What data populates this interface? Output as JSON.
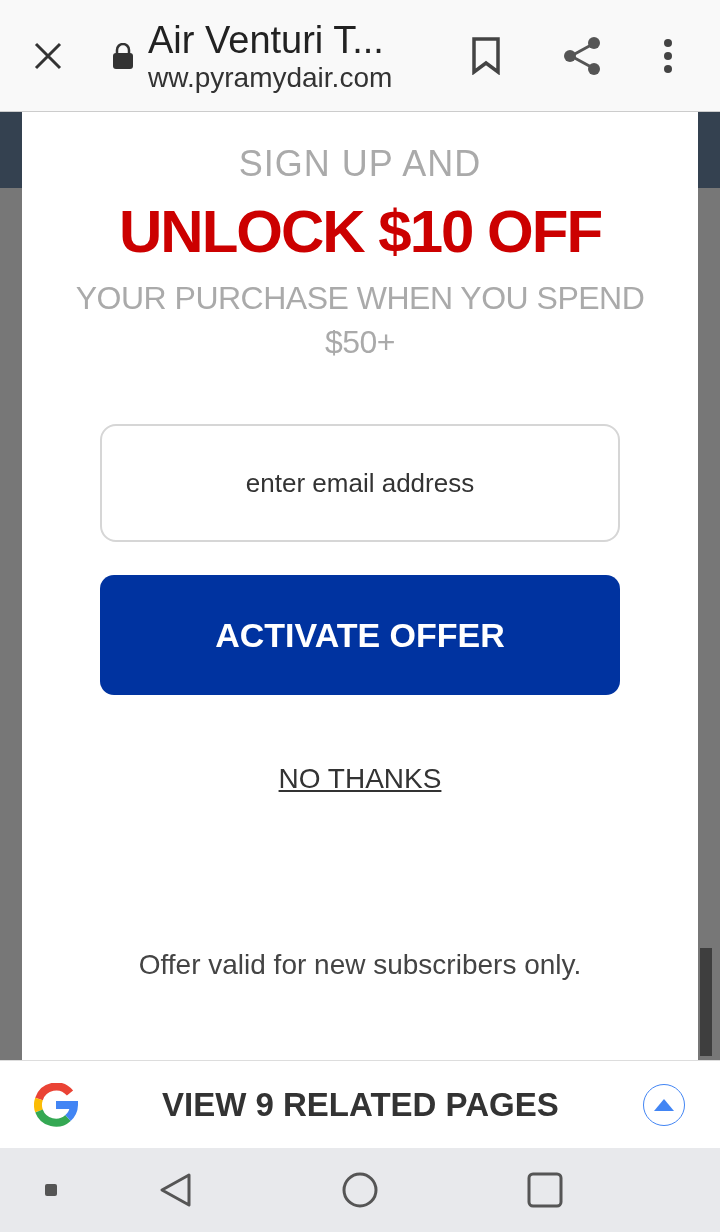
{
  "browser": {
    "title": "Air Venturi T...",
    "url": "ww.pyramydair.com"
  },
  "popup": {
    "kicker": "SIGN UP AND",
    "headline": "UNLOCK $10 OFF",
    "subline": "YOUR PURCHASE WHEN YOU SPEND $50+",
    "email": {
      "placeholder": "enter email address"
    },
    "submit": "ACTIVATE OFFER",
    "decline": "NO THANKS",
    "note": "Offer valid for new subscribers only."
  },
  "related_bar": {
    "label": "VIEW 9 RELATED PAGES"
  }
}
